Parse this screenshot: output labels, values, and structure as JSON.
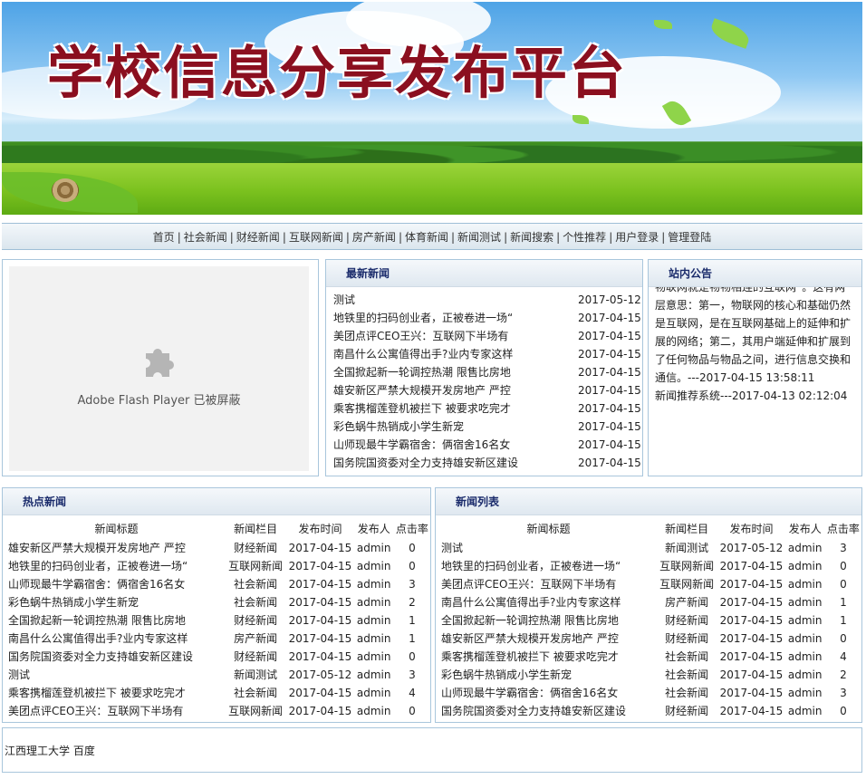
{
  "banner": {
    "title": "学校信息分享发布平台"
  },
  "nav": {
    "items": [
      "首页",
      "社会新闻",
      "财经新闻",
      "互联网新闻",
      "房产新闻",
      "体育新闻",
      "新闻测试",
      "新闻搜索",
      "个性推荐",
      "用户登录",
      "管理登陆"
    ]
  },
  "flash": {
    "message": "Adobe Flash Player 已被屏蔽",
    "icon": "puzzle-plugin-icon"
  },
  "latest": {
    "heading": "最新新闻",
    "items": [
      {
        "title": "测试",
        "date": "2017-05-12"
      },
      {
        "title": "地铁里的扫码创业者，正被卷进一场“",
        "date": "2017-04-15"
      },
      {
        "title": "美团点评CEO王兴：互联网下半场有",
        "date": "2017-04-15"
      },
      {
        "title": "南昌什么公寓值得出手?业内专家这样",
        "date": "2017-04-15"
      },
      {
        "title": "全国掀起新一轮调控热潮 限售比房地",
        "date": "2017-04-15"
      },
      {
        "title": "雄安新区严禁大规模开发房地产 严控",
        "date": "2017-04-15"
      },
      {
        "title": "乘客携榴莲登机被拦下 被要求吃完才",
        "date": "2017-04-15"
      },
      {
        "title": "彩色蜗牛热销成小学生新宠",
        "date": "2017-04-15"
      },
      {
        "title": "山师现最牛学霸宿舍：俩宿舍16名女",
        "date": "2017-04-15"
      },
      {
        "title": "国务院国资委对全力支持雄安新区建设",
        "date": "2017-04-15"
      }
    ]
  },
  "notice": {
    "heading": "站内公告",
    "text1": "物联网就是物物相连的互联网”。这有两层意思：第一，物联网的核心和基础仍然是互联网，是在互联网基础上的延伸和扩展的网络；第二，其用户端延伸和扩展到了任何物品与物品之间，进行信息交换和通信。---2017-04-15 13:58:11",
    "text2": "新闻推荐系统---2017-04-13 02:12:04"
  },
  "hot": {
    "heading": "热点新闻",
    "columns": [
      "新闻标题",
      "新闻栏目",
      "发布时间",
      "发布人",
      "点击率"
    ],
    "rows": [
      [
        "雄安新区严禁大规模开发房地产 严控",
        "财经新闻",
        "2017-04-15",
        "admin",
        "0"
      ],
      [
        "地铁里的扫码创业者，正被卷进一场“",
        "互联网新闻",
        "2017-04-15",
        "admin",
        "0"
      ],
      [
        "山师现最牛学霸宿舍：俩宿舍16名女",
        "社会新闻",
        "2017-04-15",
        "admin",
        "3"
      ],
      [
        "彩色蜗牛热销成小学生新宠",
        "社会新闻",
        "2017-04-15",
        "admin",
        "2"
      ],
      [
        "全国掀起新一轮调控热潮 限售比房地",
        "财经新闻",
        "2017-04-15",
        "admin",
        "1"
      ],
      [
        "南昌什么公寓值得出手?业内专家这样",
        "房产新闻",
        "2017-04-15",
        "admin",
        "1"
      ],
      [
        "国务院国资委对全力支持雄安新区建设",
        "财经新闻",
        "2017-04-15",
        "admin",
        "0"
      ],
      [
        "测试",
        "新闻测试",
        "2017-05-12",
        "admin",
        "3"
      ],
      [
        "乘客携榴莲登机被拦下 被要求吃完才",
        "社会新闻",
        "2017-04-15",
        "admin",
        "4"
      ],
      [
        "美团点评CEO王兴：互联网下半场有",
        "互联网新闻",
        "2017-04-15",
        "admin",
        "0"
      ]
    ]
  },
  "newslist": {
    "heading": "新闻列表",
    "columns": [
      "新闻标题",
      "新闻栏目",
      "发布时间",
      "发布人",
      "点击率"
    ],
    "rows": [
      [
        "测试",
        "新闻测试",
        "2017-05-12",
        "admin",
        "3"
      ],
      [
        "地铁里的扫码创业者，正被卷进一场“",
        "互联网新闻",
        "2017-04-15",
        "admin",
        "0"
      ],
      [
        "美团点评CEO王兴：互联网下半场有",
        "互联网新闻",
        "2017-04-15",
        "admin",
        "0"
      ],
      [
        "南昌什么公寓值得出手?业内专家这样",
        "房产新闻",
        "2017-04-15",
        "admin",
        "1"
      ],
      [
        "全国掀起新一轮调控热潮 限售比房地",
        "财经新闻",
        "2017-04-15",
        "admin",
        "1"
      ],
      [
        "雄安新区严禁大规模开发房地产 严控",
        "财经新闻",
        "2017-04-15",
        "admin",
        "0"
      ],
      [
        "乘客携榴莲登机被拦下 被要求吃完才",
        "社会新闻",
        "2017-04-15",
        "admin",
        "4"
      ],
      [
        "彩色蜗牛热销成小学生新宠",
        "社会新闻",
        "2017-04-15",
        "admin",
        "2"
      ],
      [
        "山师现最牛学霸宿舍：俩宿舍16名女",
        "社会新闻",
        "2017-04-15",
        "admin",
        "3"
      ],
      [
        "国务院国资委对全力支持雄安新区建设",
        "财经新闻",
        "2017-04-15",
        "admin",
        "0"
      ]
    ]
  },
  "footer": {
    "links": [
      "江西理工大学",
      "百度"
    ]
  },
  "colors": {
    "title_red": "#8b0f1f",
    "heading_blue": "#1a2b6b",
    "border_blue": "#a9c6dc"
  }
}
